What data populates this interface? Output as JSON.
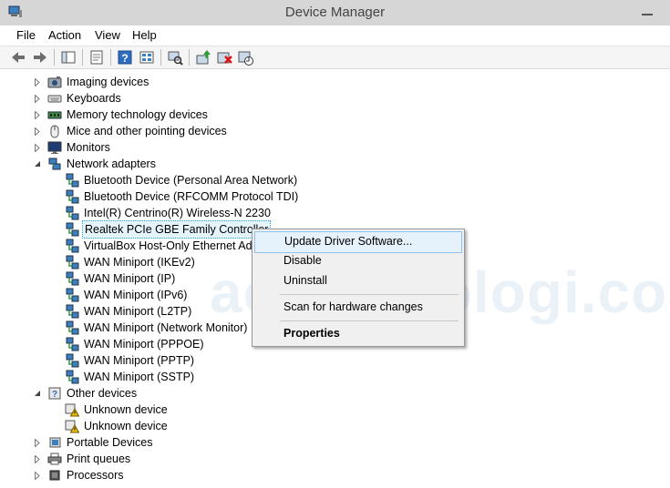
{
  "window": {
    "title": "Device Manager"
  },
  "menu": [
    "File",
    "Action",
    "View",
    "Help"
  ],
  "toolbar": [
    "back-icon",
    "forward-icon",
    "show-hide-tree-icon",
    "properties-icon",
    "help-icon",
    "view-icon",
    "scan-hardware-icon",
    "update-driver-icon",
    "uninstall-icon",
    "disable-icon"
  ],
  "tree": [
    {
      "label": "Imaging devices",
      "icon": "imaging-icon"
    },
    {
      "label": "Keyboards",
      "icon": "keyboard-icon"
    },
    {
      "label": "Memory technology devices",
      "icon": "memory-icon"
    },
    {
      "label": "Mice and other pointing devices",
      "icon": "mouse-icon"
    },
    {
      "label": "Monitors",
      "icon": "monitor-icon"
    },
    {
      "label": "Network adapters",
      "icon": "network-icon"
    },
    {
      "label": "Bluetooth Device (Personal Area Network)",
      "icon": "network-adapter-icon"
    },
    {
      "label": "Bluetooth Device (RFCOMM Protocol TDI)",
      "icon": "network-adapter-icon"
    },
    {
      "label": "Intel(R) Centrino(R) Wireless-N 2230",
      "icon": "network-adapter-icon"
    },
    {
      "label": "Realtek PCIe GBE Family Controller",
      "icon": "network-adapter-icon"
    },
    {
      "label": "VirtualBox Host-Only Ethernet Adap",
      "icon": "network-adapter-icon"
    },
    {
      "label": "WAN Miniport (IKEv2)",
      "icon": "network-adapter-icon"
    },
    {
      "label": "WAN Miniport (IP)",
      "icon": "network-adapter-icon"
    },
    {
      "label": "WAN Miniport (IPv6)",
      "icon": "network-adapter-icon"
    },
    {
      "label": "WAN Miniport (L2TP)",
      "icon": "network-adapter-icon"
    },
    {
      "label": "WAN Miniport (Network Monitor)",
      "icon": "network-adapter-icon"
    },
    {
      "label": "WAN Miniport (PPPOE)",
      "icon": "network-adapter-icon"
    },
    {
      "label": "WAN Miniport (PPTP)",
      "icon": "network-adapter-icon"
    },
    {
      "label": "WAN Miniport (SSTP)",
      "icon": "network-adapter-icon"
    },
    {
      "label": "Other devices",
      "icon": "other-devices-icon"
    },
    {
      "label": "Unknown device",
      "icon": "unknown-device-warning-icon"
    },
    {
      "label": "Unknown device",
      "icon": "unknown-device-warning-icon"
    },
    {
      "label": "Portable Devices",
      "icon": "portable-device-icon"
    },
    {
      "label": "Print queues",
      "icon": "printer-icon"
    },
    {
      "label": "Processors",
      "icon": "processor-icon"
    }
  ],
  "context_menu": {
    "update": "Update Driver Software...",
    "disable": "Disable",
    "uninstall": "Uninstall",
    "scan": "Scan for hardware changes",
    "properties": "Properties"
  },
  "watermark": "acoteknologi.com",
  "colors": {
    "selection": "#e5f3fb",
    "selection_border": "#26a0da",
    "menu_hover": "#e5f1fb"
  }
}
